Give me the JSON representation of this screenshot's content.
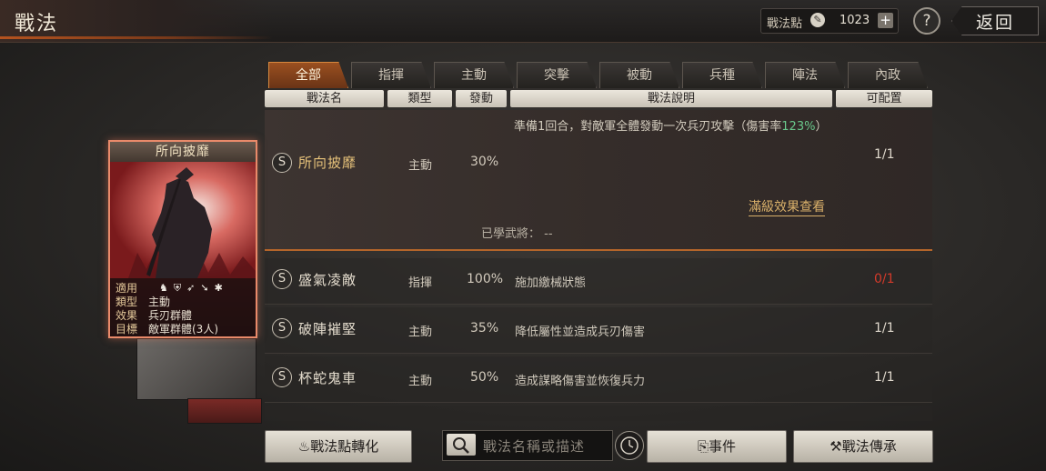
{
  "header": {
    "title": "戰法",
    "points_label": "戰法點",
    "points_value": "1023",
    "plus": "+",
    "help": "?",
    "back": "返回"
  },
  "tabs": [
    "全部",
    "指揮",
    "主動",
    "突擊",
    "被動",
    "兵種",
    "陣法",
    "內政"
  ],
  "columns": {
    "name": "戰法名",
    "type": "類型",
    "rate": "發動",
    "desc": "戰法說明",
    "count": "可配置"
  },
  "selected": {
    "badge": "S",
    "name": "所向披靡",
    "type": "主動",
    "rate": "30%",
    "desc_part1": "準備1回合，對敵軍全體發動一次兵刃攻擊（傷害率",
    "desc_highlight": "123%",
    "desc_part2": "）",
    "count": "1/1",
    "full_effect": "滿級效果查看",
    "learned_label": "已學武將：",
    "learned_value": "--"
  },
  "rows": [
    {
      "badge": "S",
      "name": "盛氣凌敵",
      "type": "指揮",
      "rate": "100%",
      "desc": "施加繳械狀態",
      "count": "0/1"
    },
    {
      "badge": "S",
      "name": "破陣摧堅",
      "type": "主動",
      "rate": "35%",
      "desc": "降低屬性並造成兵刃傷害",
      "count": "1/1"
    },
    {
      "badge": "S",
      "name": "杯蛇鬼車",
      "type": "主動",
      "rate": "50%",
      "desc": "造成謀略傷害並恢復兵力",
      "count": "1/1"
    }
  ],
  "card": {
    "title": "所向披靡",
    "applicable_label": "適用",
    "type_label": "類型",
    "type_value": "主動",
    "effect_label": "效果",
    "effect_value": "兵刃群體",
    "target_label": "目標",
    "target_value": "敵軍群體(3人)"
  },
  "bottom": {
    "convert": "戰法點轉化",
    "search_placeholder": "戰法名稱或描述",
    "events": "事件",
    "inherit": "戰法傳承"
  },
  "colors": {
    "accent": "#b5531f",
    "gold": "#e7c27a",
    "red": "#d33a2a",
    "green": "#6ac88c"
  }
}
